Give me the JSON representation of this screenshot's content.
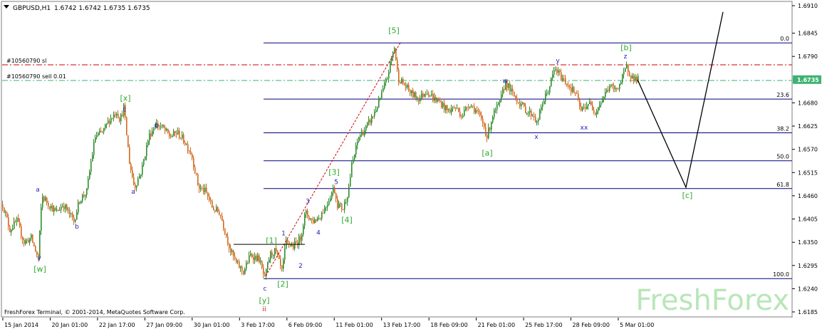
{
  "header": {
    "symbol_text": "GBPUSD,H1",
    "ohlc_text": "1.6742 1.6742 1.6735 1.6735"
  },
  "footer": {
    "copyright": "FreshForex Terminal, © 2001-2014, MetaQuotes Software Corp."
  },
  "watermark": "FreshForex",
  "colors": {
    "background": "#ffffff",
    "frame": "#7f7f7f",
    "bull_candle": "#2e8b2e",
    "bear_candle": "#d2691e",
    "fib_line": "#000080",
    "sl_line": "#cc0000",
    "order_line": "#3cb371",
    "price_tag_bg": "#3cb371",
    "wave_green": "#2fa82f",
    "wave_blue": "#1f1fbf",
    "wave_red": "#cc0000",
    "trendline": "#cc0000",
    "projection": "#000000",
    "watermark": "#b8e6b8"
  },
  "chart_data": {
    "type": "candlestick",
    "symbol": "GBPUSD",
    "timeframe": "H1",
    "ylim": [
      1.618,
      1.691
    ],
    "y_ticks": [
      "1.6910",
      "1.6845",
      "1.6790",
      "1.6735",
      "1.6680",
      "1.6625",
      "1.6570",
      "1.6515",
      "1.6460",
      "1.6405",
      "1.6350",
      "1.6295",
      "1.6240",
      "1.6185"
    ],
    "current_price": "1.6735",
    "x_ticks": [
      "15 Jan 2014",
      "20 Jan 01:00",
      "22 Jan 17:00",
      "27 Jan 09:00",
      "30 Jan 01:00",
      "3 Feb 17:00",
      "6 Feb 09:00",
      "11 Feb 01:00",
      "13 Feb 17:00",
      "18 Feb 09:00",
      "21 Feb 01:00",
      "25 Feb 17:00",
      "28 Feb 09:00",
      "5 Mar 01:00"
    ],
    "x_range": [
      0,
      1108
    ],
    "price_path": [
      [
        0,
        1.644
      ],
      [
        10,
        1.638
      ],
      [
        20,
        1.64
      ],
      [
        30,
        1.635
      ],
      [
        40,
        1.636
      ],
      [
        50,
        1.631
      ],
      [
        55,
        1.646
      ],
      [
        65,
        1.644
      ],
      [
        75,
        1.642
      ],
      [
        85,
        1.644
      ],
      [
        100,
        1.64
      ],
      [
        108,
        1.645
      ],
      [
        118,
        1.647
      ],
      [
        124,
        1.654
      ],
      [
        130,
        1.66
      ],
      [
        140,
        1.661
      ],
      [
        150,
        1.664
      ],
      [
        160,
        1.666
      ],
      [
        165,
        1.664
      ],
      [
        170,
        1.667
      ],
      [
        178,
        1.654
      ],
      [
        185,
        1.648
      ],
      [
        195,
        1.652
      ],
      [
        205,
        1.66
      ],
      [
        215,
        1.663
      ],
      [
        225,
        1.662
      ],
      [
        235,
        1.66
      ],
      [
        245,
        1.661
      ],
      [
        255,
        1.659
      ],
      [
        265,
        1.656
      ],
      [
        275,
        1.648
      ],
      [
        285,
        1.647
      ],
      [
        295,
        1.643
      ],
      [
        305,
        1.642
      ],
      [
        315,
        1.636
      ],
      [
        320,
        1.633
      ],
      [
        328,
        1.63
      ],
      [
        338,
        1.628
      ],
      [
        348,
        1.632
      ],
      [
        360,
        1.631
      ],
      [
        368,
        1.6262
      ],
      [
        375,
        1.632
      ],
      [
        383,
        1.633
      ],
      [
        392,
        1.628
      ],
      [
        398,
        1.635
      ],
      [
        408,
        1.634
      ],
      [
        418,
        1.636
      ],
      [
        425,
        1.642
      ],
      [
        435,
        1.64
      ],
      [
        445,
        1.641
      ],
      [
        455,
        1.644
      ],
      [
        465,
        1.648
      ],
      [
        470,
        1.644
      ],
      [
        478,
        1.643
      ],
      [
        485,
        1.647
      ],
      [
        490,
        1.653
      ],
      [
        500,
        1.66
      ],
      [
        510,
        1.662
      ],
      [
        520,
        1.665
      ],
      [
        530,
        1.669
      ],
      [
        540,
        1.674
      ],
      [
        545,
        1.678
      ],
      [
        550,
        1.6812
      ],
      [
        555,
        1.674
      ],
      [
        565,
        1.672
      ],
      [
        575,
        1.67
      ],
      [
        585,
        1.669
      ],
      [
        595,
        1.671
      ],
      [
        605,
        1.669
      ],
      [
        615,
        1.668
      ],
      [
        625,
        1.666
      ],
      [
        635,
        1.667
      ],
      [
        645,
        1.665
      ],
      [
        655,
        1.668
      ],
      [
        665,
        1.666
      ],
      [
        675,
        1.663
      ],
      [
        680,
        1.66
      ],
      [
        688,
        1.665
      ],
      [
        698,
        1.668
      ],
      [
        706,
        1.673
      ],
      [
        716,
        1.67
      ],
      [
        726,
        1.668
      ],
      [
        736,
        1.666
      ],
      [
        746,
        1.665
      ],
      [
        750,
        1.663
      ],
      [
        758,
        1.668
      ],
      [
        766,
        1.671
      ],
      [
        775,
        1.676
      ],
      [
        785,
        1.674
      ],
      [
        795,
        1.672
      ],
      [
        805,
        1.67
      ],
      [
        812,
        1.666
      ],
      [
        822,
        1.668
      ],
      [
        832,
        1.666
      ],
      [
        842,
        1.669
      ],
      [
        852,
        1.672
      ],
      [
        860,
        1.671
      ],
      [
        868,
        1.673
      ],
      [
        876,
        1.6765
      ],
      [
        884,
        1.674
      ],
      [
        892,
        1.6735
      ]
    ],
    "horizontal_levels": [
      {
        "label": "0.0",
        "price": 1.6822,
        "kind": "fib"
      },
      {
        "label": "23.6",
        "price": 1.6689,
        "kind": "fib"
      },
      {
        "label": "38.2",
        "price": 1.6609,
        "kind": "fib"
      },
      {
        "label": "50.0",
        "price": 1.6543,
        "kind": "fib"
      },
      {
        "label": "61.8",
        "price": 1.6477,
        "kind": "fib"
      },
      {
        "label": "100.0",
        "price": 1.6264,
        "kind": "fib"
      },
      {
        "label": "#10560790 sl",
        "price": 1.677,
        "kind": "sl"
      },
      {
        "label": "#10560790 sell 0.01",
        "price": 1.6733,
        "kind": "order"
      }
    ],
    "projection": [
      [
        892,
        1.6735
      ],
      [
        960,
        1.648
      ],
      [
        1012,
        1.6895
      ]
    ],
    "trendline": [
      [
        370,
        1.627
      ],
      [
        560,
        1.6825
      ]
    ],
    "flat_line": [
      [
        325,
        1.6345
      ],
      [
        425,
        1.6345
      ]
    ],
    "wave_labels": [
      {
        "text": "[5]",
        "x": 550,
        "price": 1.6845,
        "color": "green"
      },
      {
        "text": "[b]",
        "x": 876,
        "price": 1.6805,
        "color": "green"
      },
      {
        "text": "z",
        "x": 875,
        "price": 1.6785,
        "color": "blue"
      },
      {
        "text": "y",
        "x": 780,
        "price": 1.6775,
        "color": "blue"
      },
      {
        "text": "w",
        "x": 706,
        "price": 1.6727,
        "color": "blue"
      },
      {
        "text": "[x]",
        "x": 173,
        "price": 1.6685,
        "color": "green"
      },
      {
        "text": "c",
        "x": 172,
        "price": 1.666,
        "color": "blue"
      },
      {
        "text": "b",
        "x": 217,
        "price": 1.6622,
        "color": "blue"
      },
      {
        "text": "xx",
        "x": 817,
        "price": 1.6617,
        "color": "blue"
      },
      {
        "text": "x",
        "x": 750,
        "price": 1.6595,
        "color": "blue"
      },
      {
        "text": "[a]",
        "x": 681,
        "price": 1.6555,
        "color": "green"
      },
      {
        "text": "[3]",
        "x": 466,
        "price": 1.651,
        "color": "green"
      },
      {
        "text": "5",
        "x": 469,
        "price": 1.6488,
        "color": "blue"
      },
      {
        "text": "a",
        "x": 50,
        "price": 1.647,
        "color": "blue"
      },
      {
        "text": "a",
        "x": 184,
        "price": 1.6465,
        "color": "blue"
      },
      {
        "text": "[c]",
        "x": 962,
        "price": 1.6455,
        "color": "green"
      },
      {
        "text": "3",
        "x": 429,
        "price": 1.6442,
        "color": "blue"
      },
      {
        "text": "[4]",
        "x": 484,
        "price": 1.6397,
        "color": "green"
      },
      {
        "text": "b",
        "x": 105,
        "price": 1.6382,
        "color": "blue"
      },
      {
        "text": "4",
        "x": 444,
        "price": 1.6368,
        "color": "blue"
      },
      {
        "text": "1",
        "x": 395,
        "price": 1.6366,
        "color": "blue"
      },
      {
        "text": "[1]",
        "x": 378,
        "price": 1.6348,
        "color": "green"
      },
      {
        "text": "y",
        "x": 52,
        "price": 1.6308,
        "color": "blue"
      },
      {
        "text": "2",
        "x": 419,
        "price": 1.629,
        "color": "blue"
      },
      {
        "text": "[w]",
        "x": 53,
        "price": 1.628,
        "color": "green"
      },
      {
        "text": "[2]",
        "x": 394,
        "price": 1.6245,
        "color": "green"
      },
      {
        "text": "c",
        "x": 369,
        "price": 1.6236,
        "color": "blue"
      },
      {
        "text": "[y]",
        "x": 368,
        "price": 1.6206,
        "color": "green"
      },
      {
        "text": "ii",
        "x": 368,
        "price": 1.6187,
        "color": "red"
      }
    ]
  }
}
